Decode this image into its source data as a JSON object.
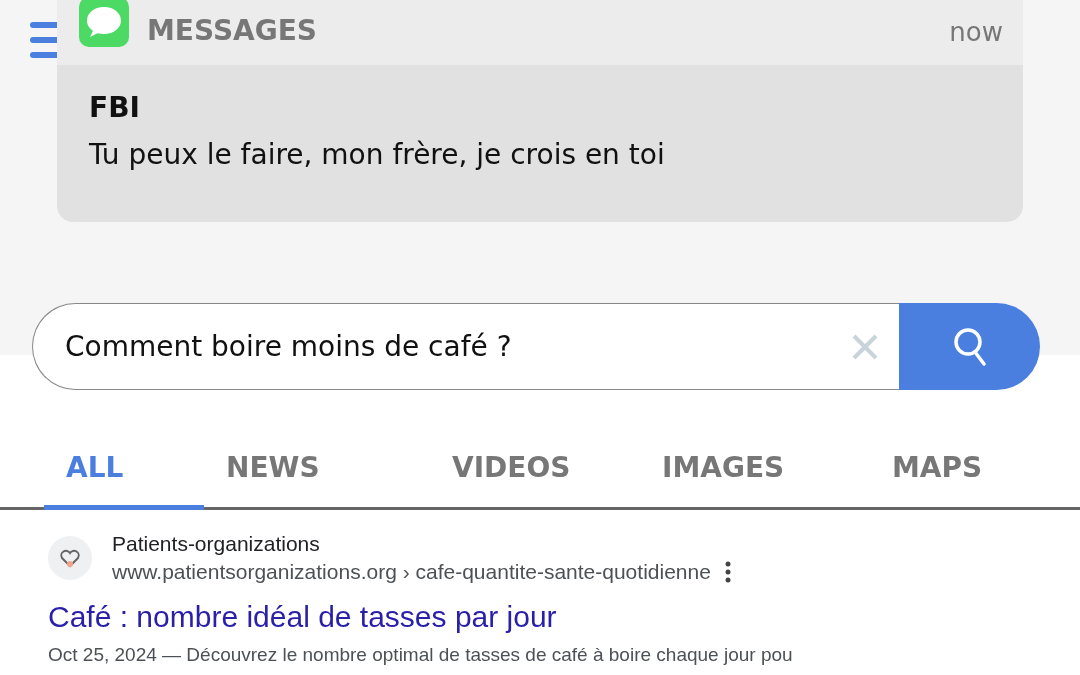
{
  "notification": {
    "app": "MESSAGES",
    "time": "now",
    "sender": "FBI",
    "message": "Tu peux le faire, mon frère, je crois en toi"
  },
  "search": {
    "value": "Comment boire moins de café ?"
  },
  "tabs": [
    {
      "label": "ALL",
      "selected": true
    },
    {
      "label": "NEWS",
      "selected": false
    },
    {
      "label": "VIDEOS",
      "selected": false
    },
    {
      "label": "IMAGES",
      "selected": false
    },
    {
      "label": "MAPS",
      "selected": false
    }
  ],
  "result": {
    "site": "Patients-organizations",
    "url": "www.patientsorganizations.org › cafe-quantite-sante-quotidienne",
    "title": "Café : nombre idéal de tasses par jour",
    "snippet": "Oct 25, 2024 — Découvrez le nombre optimal de tasses de café à boire chaque jour pou"
  }
}
